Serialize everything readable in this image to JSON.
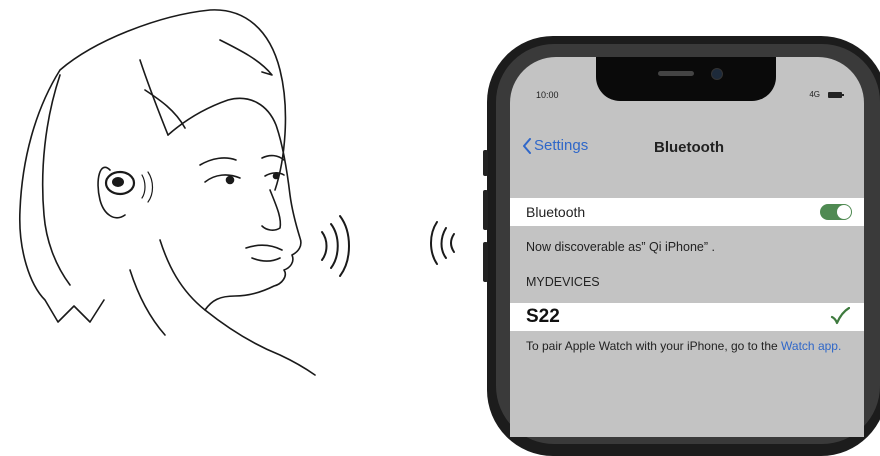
{
  "status_bar": {
    "time": "10:00",
    "network": "4G"
  },
  "nav": {
    "back_label": "Settings",
    "title": "Bluetooth"
  },
  "bluetooth": {
    "label": "Bluetooth",
    "enabled": true
  },
  "discoverable_text": "Now discoverable as” Qi iPhone” .",
  "devices_header": "MYDEVICES",
  "device": {
    "name": "S22",
    "connected": true
  },
  "pair_hint": {
    "text": "To pair Apple Watch with your iPhone, go to the ",
    "link": "Watch app."
  },
  "colors": {
    "toggle_on": "#4f8a52",
    "link": "#2f67c9",
    "checkmark": "#3e7a3e"
  },
  "icons": [
    "earbud-icon",
    "sound-wave-icon",
    "chevron-left-icon",
    "checkmark-icon",
    "battery-icon"
  ]
}
